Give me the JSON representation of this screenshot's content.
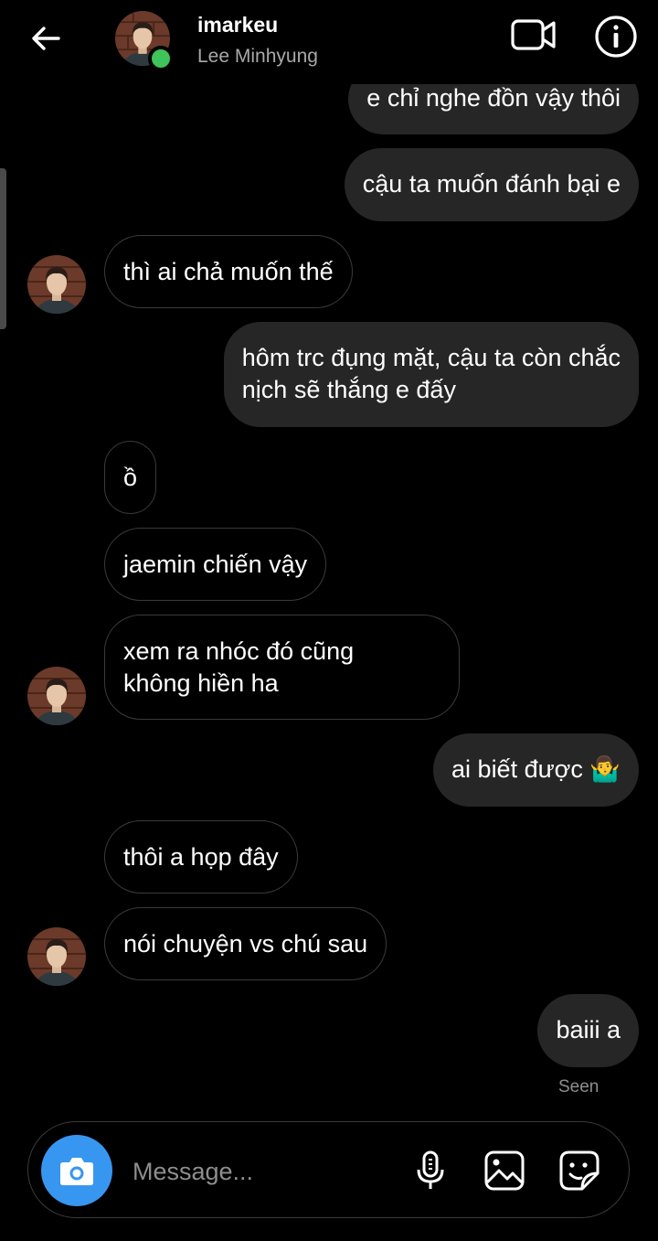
{
  "header": {
    "username": "imarkeu",
    "full_name": "Lee Minhyung",
    "online": true,
    "online_color": "#3ec45a"
  },
  "messages": [
    {
      "side": "sent",
      "text": "e chỉ nghe đồn vậy thôi"
    },
    {
      "side": "sent",
      "text": "cậu ta muốn đánh bại e"
    },
    {
      "side": "received",
      "text": "thì ai chả muốn thế",
      "avatar": true
    },
    {
      "side": "sent",
      "lines": [
        "hôm trc đụng mặt, cậu ta còn chắc",
        "nịch sẽ thắng e đấy"
      ]
    },
    {
      "side": "received",
      "text": "ồ"
    },
    {
      "side": "received",
      "text": "jaemin chiến vậy"
    },
    {
      "side": "received",
      "lines": [
        "xem ra nhóc đó cũng",
        "không hiền ha"
      ],
      "avatar": true
    },
    {
      "side": "sent",
      "text": "ai biết được 🤷‍♂️"
    },
    {
      "side": "received",
      "text": "thôi a họp đây"
    },
    {
      "side": "received",
      "text": "nói chuyện vs chú sau",
      "avatar": true
    },
    {
      "side": "sent",
      "text": "baiii a"
    }
  ],
  "seen_label": "Seen",
  "composer": {
    "placeholder": "Message...",
    "camera_color": "#3797f0"
  },
  "icons": {
    "back": "arrow-left-icon",
    "video": "video-camera-icon",
    "info": "info-icon",
    "camera": "camera-icon",
    "mic": "microphone-icon",
    "gallery": "image-gallery-icon",
    "sticker": "sticker-icon"
  }
}
